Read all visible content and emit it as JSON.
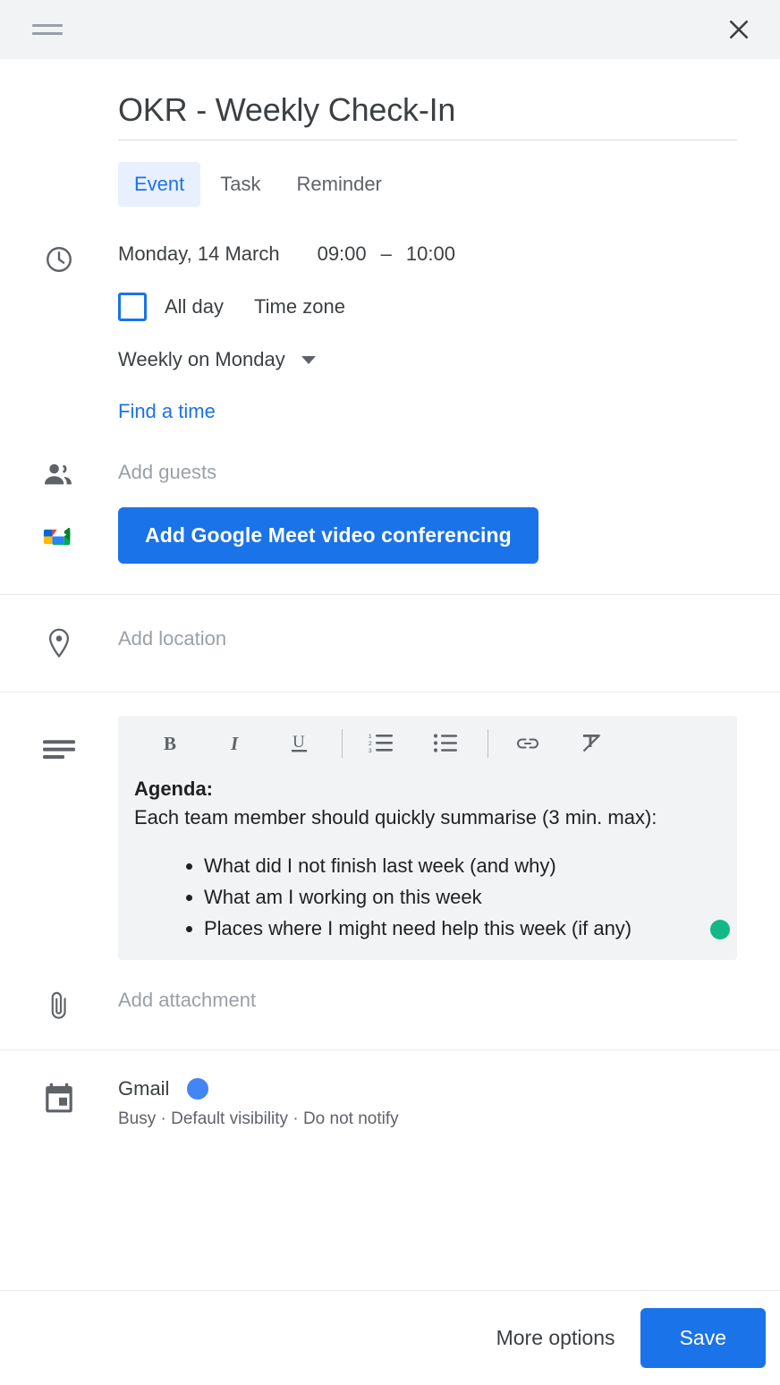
{
  "titlebar": {
    "drag_handle_name": "drag-handle",
    "close_label": "Close"
  },
  "event": {
    "title": "OKR - Weekly Check-In",
    "title_placeholder": "Add title"
  },
  "tabs": [
    {
      "label": "Event",
      "active": true
    },
    {
      "label": "Task",
      "active": false
    },
    {
      "label": "Reminder",
      "active": false
    }
  ],
  "datetime": {
    "date": "Monday, 14 March",
    "start_time": "09:00",
    "dash": "–",
    "end_time": "10:00",
    "all_day_label": "All day",
    "all_day_checked": false,
    "time_zone_label": "Time zone",
    "recurrence": "Weekly on Monday",
    "find_a_time": "Find a time"
  },
  "guests": {
    "placeholder": "Add guests"
  },
  "meet": {
    "button_label": "Add Google Meet video conferencing"
  },
  "location": {
    "placeholder": "Add location"
  },
  "description": {
    "toolbar": [
      {
        "name": "bold",
        "glyph": "B"
      },
      {
        "name": "italic",
        "glyph": "I"
      },
      {
        "name": "underline",
        "glyph": "U"
      },
      {
        "name": "numbered-list",
        "glyph": "1."
      },
      {
        "name": "bulleted-list",
        "glyph": "•"
      },
      {
        "name": "insert-link",
        "glyph": "🔗"
      },
      {
        "name": "remove-formatting",
        "glyph": "Tx"
      }
    ],
    "heading": "Agenda:",
    "intro": "Each team member should quickly summarise (3 min. max):",
    "bullets": [
      "What did I not finish last week (and why)",
      "What am I working on this week",
      "Places where I might need help this week (if any)"
    ],
    "cursor_color": "#12b886"
  },
  "attachment": {
    "placeholder": "Add attachment"
  },
  "calendar": {
    "name": "Gmail",
    "color": "#4285f4",
    "details": "Busy · Default visibility · Do not notify"
  },
  "footer": {
    "more_options": "More options",
    "save": "Save"
  },
  "colors": {
    "accent": "#1a73e8",
    "tab_active_bg": "#e8f0fe",
    "titlebar_bg": "#f1f3f4",
    "editor_bg": "#f1f3f4",
    "muted_text": "#5f6368",
    "placeholder_text": "#9aa0a6"
  }
}
